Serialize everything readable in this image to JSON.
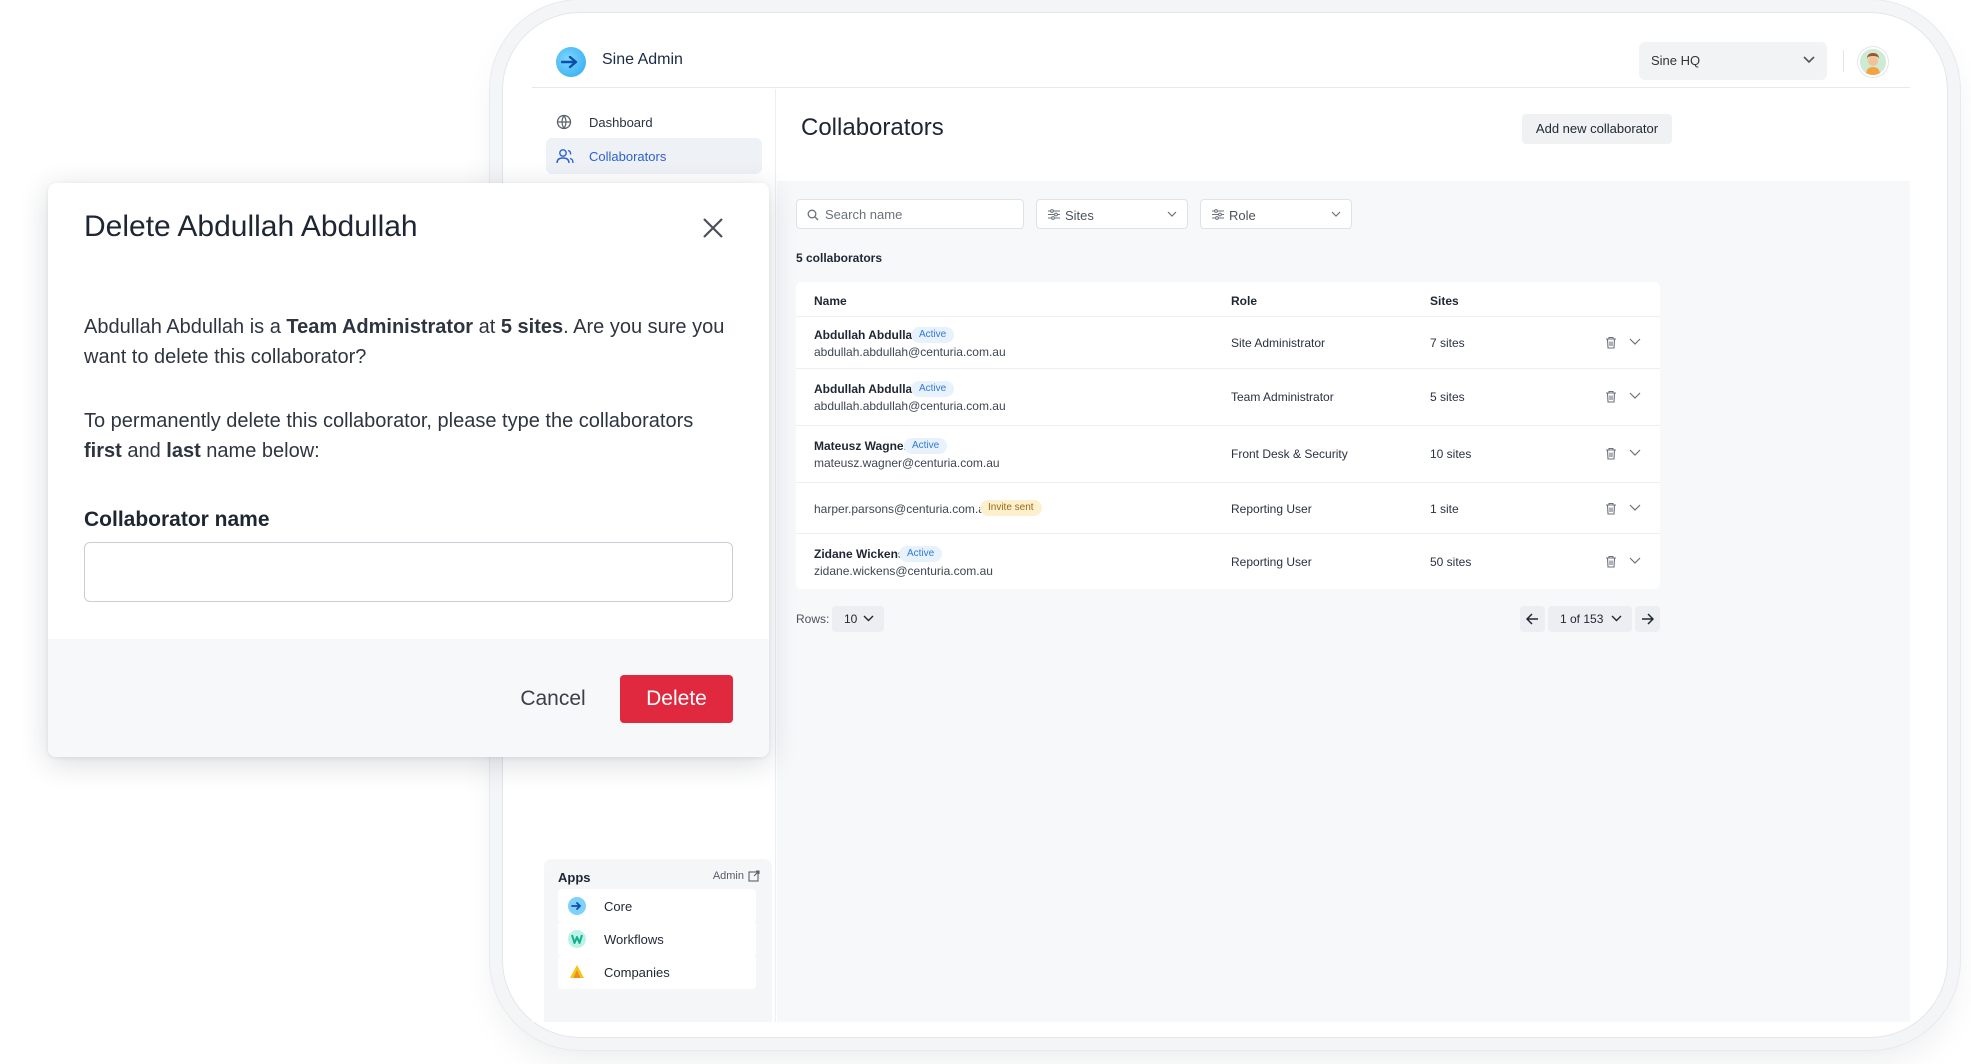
{
  "app": {
    "name": "Sine Admin",
    "workspace": "Sine HQ"
  },
  "sidebar": {
    "items": [
      {
        "label": "Dashboard",
        "icon": "globe-icon"
      },
      {
        "label": "Collaborators",
        "icon": "users-icon",
        "active": true
      }
    ],
    "apps": {
      "title": "Apps",
      "admin_label": "Admin",
      "items": [
        {
          "label": "Core",
          "color": "#2aa8f0"
        },
        {
          "label": "Workflows",
          "color": "#2ed3b7"
        },
        {
          "label": "Companies",
          "color": "#f5c518"
        }
      ]
    }
  },
  "main": {
    "title": "Collaborators",
    "add_button": "Add new collaborator",
    "search_placeholder": "Search name",
    "filters": [
      "Sites",
      "Role"
    ],
    "count": "5 collaborators",
    "columns": [
      "Name",
      "Role",
      "Sites"
    ],
    "rows": [
      {
        "name": "Abdullah Abdullah",
        "status": "Active",
        "email": "abdullah.abdullah@centuria.com.au",
        "role": "Site Administrator",
        "sites": "7 sites"
      },
      {
        "name": "Abdullah Abdullah",
        "status": "Active",
        "email": "abdullah.abdullah@centuria.com.au",
        "role": "Team Administrator",
        "sites": "5 sites"
      },
      {
        "name": "Mateusz Wagner",
        "status": "Active",
        "email": "mateusz.wagner@centuria.com.au",
        "role": "Front Desk & Security",
        "sites": "10 sites"
      },
      {
        "name": "",
        "status": "Invite sent",
        "email": "harper.parsons@centuria.com.au",
        "role": "Reporting User",
        "sites": "1 site"
      },
      {
        "name": "Zidane Wickens",
        "status": "Active",
        "email": "zidane.wickens@centuria.com.au",
        "role": "Reporting User",
        "sites": "50 sites"
      }
    ],
    "pagination": {
      "rows_label": "Rows:",
      "rows_value": "10",
      "page_label": "1 of 153"
    }
  },
  "modal": {
    "title": "Delete Abdullah Abdullah",
    "p1_a": "Abdullah Abdullah is a ",
    "p1_b": "Team Administrator",
    "p1_c": " at ",
    "p1_d": "5 sites",
    "p1_e": ". Are you sure you want to delete this collaborator?",
    "p2_a": "To permanently delete this collaborator, please type the collaborators ",
    "p2_b": "first",
    "p2_c": " and ",
    "p2_d": "last",
    "p2_e": " name below:",
    "field_label": "Collaborator name",
    "field_value": "",
    "cancel": "Cancel",
    "delete": "Delete"
  },
  "colors": {
    "accent": "#2d5fd3",
    "danger": "#e0283e",
    "active_badge": "#2f78d8",
    "invite_badge": "#9a6a10"
  }
}
